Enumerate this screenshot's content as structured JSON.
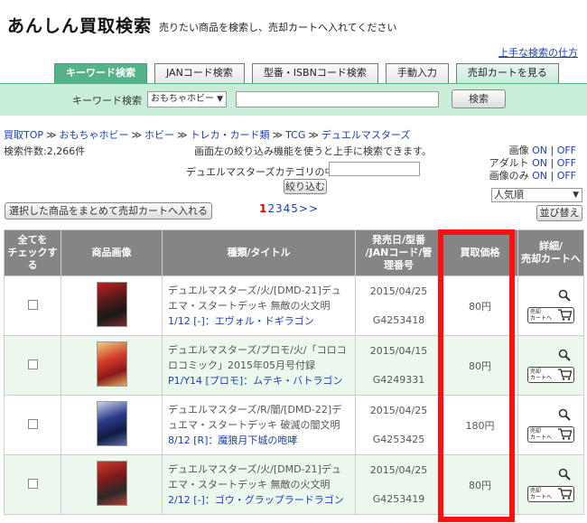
{
  "header": {
    "title": "あんしん買取検索",
    "subtitle": "売りたい商品を検索し、売却カートへ入れてください",
    "howto_link": "上手な検索の仕方"
  },
  "tabs": [
    {
      "label": "キーワード検索",
      "active": true
    },
    {
      "label": "JANコード検索",
      "active": false
    },
    {
      "label": "型番・ISBNコード検索",
      "active": false
    },
    {
      "label": "手動入力",
      "active": false
    },
    {
      "label": "売却カートを見る",
      "active": false
    }
  ],
  "search": {
    "label": "キーワード検索",
    "category_selected": "おもちゃホビー",
    "keyword_value": "",
    "button": "検索"
  },
  "breadcrumb": [
    "買取TOP",
    "おもちゃホビー",
    "ホビー",
    "トレカ・カード類",
    "TCG",
    "デュエルマスターズ"
  ],
  "breadcrumb_sep": "≫",
  "info": {
    "count": "検索件数:2,266件",
    "hint": "画面左の絞り込み機能を使うと上手に検索できます。"
  },
  "filter": {
    "label": "デュエルマスターズカテゴリの中から",
    "value": "",
    "button": "絞り込む"
  },
  "options": [
    {
      "label": "画像",
      "on": "ON",
      "off": "OFF"
    },
    {
      "label": "アダルト",
      "on": "ON",
      "off": "OFF"
    },
    {
      "label": "画像のみ",
      "on": "ON",
      "off": "OFF"
    }
  ],
  "sort": {
    "selected": "人気順",
    "button": "並び替え"
  },
  "bulk_button": "選択した商品をまとめて売却カートへ入れる",
  "pager": {
    "current": "1",
    "pages": [
      "2",
      "3",
      "4",
      "5"
    ],
    "next": ">>"
  },
  "table": {
    "headers": [
      "全てを\nチェックする",
      "商品画像",
      "種類/タイトル",
      "発売日/型番\n/JANコード/管\n理番号",
      "買取価格",
      "詳細/\n売却カートへ"
    ],
    "rows": [
      {
        "title": "デュエルマスターズ/火/[DMD-21]デュエマ・スタートデッキ 無敵の火文明",
        "cardno": "1/12 [-]：エヴォル・ドギラゴン",
        "date": "2015/04/25",
        "code": "G4253418",
        "price": "80円",
        "cart_label": "売却\nカートへ"
      },
      {
        "title": "デュエルマスターズ/プロモ/火/「コロコロコミック」2015年05月号付録",
        "cardno": "P1/Y14 [プロモ]：ムテキ・バトラゴン",
        "date": "2015/04/15",
        "code": "G4249331",
        "price": "80円",
        "cart_label": "売却\nカートへ"
      },
      {
        "title": "デュエルマスターズ/R/闇/[DMD-22]デュエマ・スタートデッキ 破滅の闇文明",
        "cardno": "8/12 [R]：魔狼月下城の咆哮",
        "date": "2015/04/25",
        "code": "G4253425",
        "price": "180円",
        "cart_label": "売却\nカートへ"
      },
      {
        "title": "デュエルマスターズ/火/[DMD-21]デュエマ・スタートデッキ 無敵の火文明",
        "cardno": "2/12 [-]：ゴウ・グラップラードラゴン",
        "date": "2015/04/25",
        "code": "G4253419",
        "price": "80円",
        "cart_label": "売却\nカートへ"
      }
    ]
  },
  "colors": {
    "accent": "#56b28a",
    "searchbar": "#c9eed8",
    "link": "#1a3fb5",
    "highlight": "#ff1010",
    "header_bg": "#858585"
  }
}
